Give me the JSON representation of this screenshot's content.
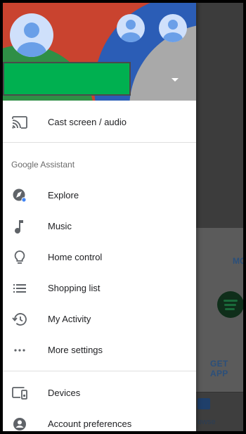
{
  "background": {
    "more_label": "MO",
    "get_app_label": "GET APP",
    "nav_label": "owse"
  },
  "drawer": {
    "header": {
      "account_color": "#00b050"
    },
    "cast": {
      "label": "Cast screen / audio",
      "icon": "cast-icon"
    },
    "section_title": "Google Assistant",
    "assistant_items": [
      {
        "label": "Explore",
        "icon": "explore-compass-icon"
      },
      {
        "label": "Music",
        "icon": "music-note-icon"
      },
      {
        "label": "Home control",
        "icon": "lightbulb-icon"
      },
      {
        "label": "Shopping list",
        "icon": "list-icon"
      },
      {
        "label": "My Activity",
        "icon": "history-icon"
      },
      {
        "label": "More settings",
        "icon": "more-horiz-icon"
      }
    ],
    "devices": {
      "label": "Devices",
      "icon": "devices-icon"
    },
    "account_prefs": {
      "label": "Account preferences",
      "icon": "account-circle-icon"
    }
  }
}
